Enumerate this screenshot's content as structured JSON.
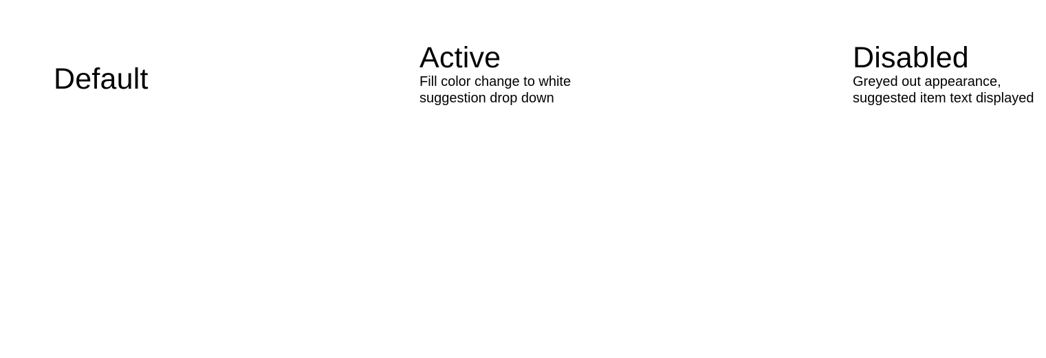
{
  "states": {
    "default": {
      "title": "Default"
    },
    "active": {
      "title": "Active",
      "description_line1": "Fill color change to white",
      "description_line2": "suggestion drop down"
    },
    "disabled": {
      "title": "Disabled",
      "description_line1": "Greyed out appearance,",
      "description_line2": "suggested item text displayed"
    }
  }
}
